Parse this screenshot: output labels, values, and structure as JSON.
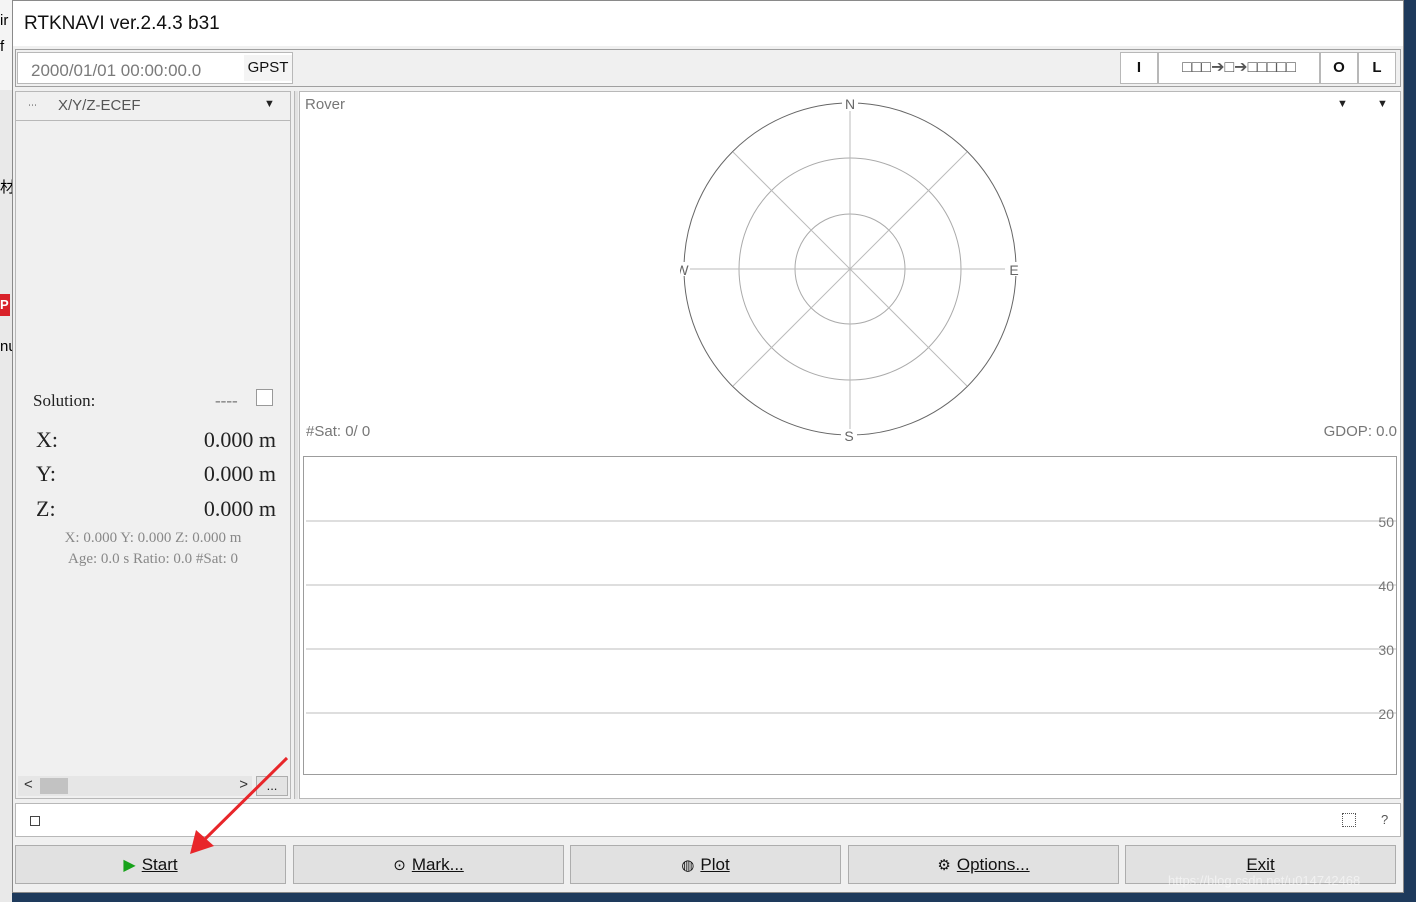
{
  "window": {
    "title": "RTKNAVI ver.2.4.3 b31"
  },
  "desktop": {
    "left_fragments": [
      "ir",
      "f",
      "P",
      "nu"
    ],
    "left_fragment_cjk": "材"
  },
  "topbar": {
    "time": "2000/01/01 00:00:00.0",
    "time_system": "GPST",
    "input_label": "I",
    "stream_indicator": "□□□➔□➔□□□□□",
    "output_label": "O",
    "log_label": "L"
  },
  "left_panel": {
    "mode": "X/Y/Z-ECEF",
    "solution_label": "Solution:",
    "solution_status": "----",
    "coords": [
      {
        "key": "X:",
        "value": "0.000 m"
      },
      {
        "key": "Y:",
        "value": "0.000 m"
      },
      {
        "key": "Z:",
        "value": "0.000 m"
      }
    ],
    "info_line1": "X: 0.000 Y: 0.000 Z: 0.000 m",
    "info_line2": "Age: 0.0 s Ratio: 0.0 #Sat: 0",
    "more_button": "..."
  },
  "right_panel": {
    "title": "Rover",
    "nsat": "#Sat: 0/ 0",
    "gdop": "GDOP: 0.0",
    "skyplot": {
      "n": "N",
      "s": "S",
      "e": "E",
      "w": "W"
    }
  },
  "chart_data": {
    "type": "bar",
    "title": "",
    "xlabel": "",
    "ylabel": "",
    "y_ticks": [
      "50",
      "40",
      "30",
      "20"
    ],
    "categories": [],
    "values": [],
    "grid": true
  },
  "statusbar": {
    "help": "?"
  },
  "buttons": {
    "start": "Start",
    "mark": "Mark...",
    "plot": "Plot",
    "options": "Options...",
    "exit": "Exit"
  },
  "icons": {
    "start": "play-icon",
    "mark": "target-icon",
    "plot": "globe-icon",
    "options": "gear-icon"
  },
  "colors": {
    "play": "#17a21a",
    "annotation_arrow": "#e8262a",
    "desktop": "#1e3a5c"
  },
  "watermark": "https://blog.csdn.net/u014742468"
}
